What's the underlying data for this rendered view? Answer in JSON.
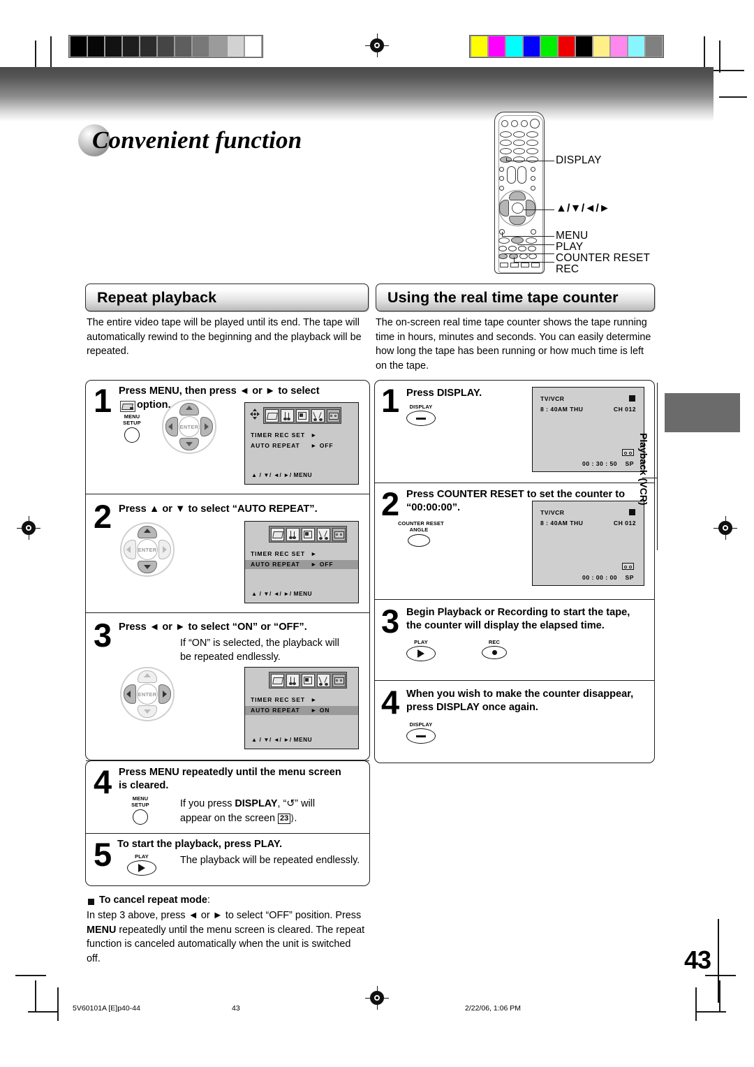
{
  "page": {
    "title": "Convenient function",
    "number": "43",
    "side_tab_label": "Playback (VCR)"
  },
  "footer": {
    "file": "5V60101A [E]p40-44",
    "page": "43",
    "date": "2/22/06, 1:06 PM"
  },
  "color_bars": {
    "grayscale": [
      "#000000",
      "#070707",
      "#121212",
      "#1d1d1d",
      "#2c2c2c",
      "#454545",
      "#5e5e5e",
      "#787878",
      "#9b9b9b",
      "#d2d2d2",
      "#ffffff"
    ],
    "colors": [
      "#ffff00",
      "#ff00ff",
      "#00ffff",
      "#0000ff",
      "#00ee00",
      "#ee0000",
      "#000000",
      "#ffef88",
      "#ff88ee",
      "#88f5ff",
      "#808080"
    ]
  },
  "remote": {
    "callouts": [
      {
        "label": "DISPLAY"
      },
      {
        "label": "▲/▼/◄/►"
      },
      {
        "label": "MENU"
      },
      {
        "label": "PLAY"
      },
      {
        "label": "COUNTER RESET"
      },
      {
        "label": "REC"
      }
    ]
  },
  "left_section": {
    "heading": "Repeat playback",
    "intro": "The entire video tape will be played until its end. The tape will automatically rewind to the beginning and the playback will be repeated.",
    "steps": [
      {
        "num": "1",
        "text_a": "Press MENU, then press ◄ or ► to select",
        "text_b": "option.",
        "key": {
          "top_cap": "MENU",
          "bottom_cap": "SETUP"
        }
      },
      {
        "num": "2",
        "text_a": "Press ▲ or ▼ to select “AUTO REPEAT”."
      },
      {
        "num": "3",
        "text_a": "Press ◄ or ► to select “ON” or “OFF”.",
        "sub_a": "If “ON” is selected, the playback will",
        "sub_b": "be repeated endlessly."
      },
      {
        "num": "4",
        "text_a": "Press MENU repeatedly until the menu screen",
        "text_b": "is cleared.",
        "sub_pre": "If you press ",
        "sub_bold": "DISPLAY",
        "sub_mid": ", “↺” will",
        "sub_b": "appear on the screen",
        "sub_ref": "23",
        "key": {
          "top_cap": "MENU",
          "bottom_cap": "SETUP"
        }
      },
      {
        "num": "5",
        "text_a": "To start the playback, press PLAY.",
        "sub_a": "The playback will be repeated endlessly.",
        "key": {
          "cap": "PLAY"
        }
      }
    ],
    "note": {
      "title": "To cancel repeat mode",
      "colon": ":",
      "line1_pre": "In step 3 above, press ◄ or ► to select “OFF” position. Press",
      "line2_bold": "MENU",
      "line2_rest": " repeatedly until the menu screen is cleared. The repeat",
      "line3": "function is canceled automatically when the unit is switched",
      "line4": "off."
    },
    "osd_screens": [
      {
        "id": "osd1",
        "selected_icon_index": 4,
        "show_cursor": true,
        "rows": [
          {
            "label": "TIMER REC SET",
            "value": "►",
            "highlight": false
          },
          {
            "label": "AUTO REPEAT",
            "value": "► OFF",
            "highlight": false
          }
        ],
        "footer": "▲ / ▼/ ◄/ ►/ MENU"
      },
      {
        "id": "osd2",
        "selected_icon_index": 4,
        "show_cursor": false,
        "rows": [
          {
            "label": "TIMER REC SET",
            "value": "►",
            "highlight": false
          },
          {
            "label": "AUTO REPEAT",
            "value": "► OFF",
            "highlight": true
          }
        ],
        "footer": "▲ / ▼/ ◄/ ►/ MENU"
      },
      {
        "id": "osd3",
        "selected_icon_index": 4,
        "show_cursor": false,
        "rows": [
          {
            "label": "TIMER REC SET",
            "value": "►",
            "highlight": false
          },
          {
            "label": "AUTO REPEAT",
            "value": "► ON",
            "highlight": true
          }
        ],
        "footer": "▲ / ▼/ ◄/ ►/ MENU"
      }
    ]
  },
  "right_section": {
    "heading": "Using the real time tape counter",
    "intro": "The on-screen real time tape counter shows the tape running time in hours, minutes and seconds. You can easily determine how long the tape has been running or how much time is left on the tape.",
    "steps": [
      {
        "num": "1",
        "text_a": "Press DISPLAY.",
        "key": {
          "cap": "DISPLAY"
        }
      },
      {
        "num": "2",
        "text_a": "Press COUNTER RESET to set the counter to",
        "text_b": "“00:00:00”.",
        "key": {
          "top_cap": "COUNTER RESET",
          "bottom_cap": "ANGLE"
        }
      },
      {
        "num": "3",
        "text_a": "Begin Playback or Recording to start the tape,",
        "text_b": "the counter will display the elapsed time.",
        "key_play": {
          "cap": "PLAY"
        },
        "key_rec": {
          "cap": "REC"
        }
      },
      {
        "num": "4",
        "text_a": "When you wish to make the counter disappear,",
        "text_b": "press DISPLAY once again.",
        "key": {
          "cap": "DISPLAY"
        }
      }
    ],
    "tv_screens": [
      {
        "id": "tv1",
        "source": "TV/VCR",
        "clock": "8 : 40AM THU",
        "channel": "CH 012",
        "counter": "00 : 30 : 50",
        "speed": "SP"
      },
      {
        "id": "tv2",
        "source": "TV/VCR",
        "clock": "8 : 40AM THU",
        "channel": "CH 012",
        "counter": "00 : 00 : 00",
        "speed": "SP"
      }
    ]
  }
}
